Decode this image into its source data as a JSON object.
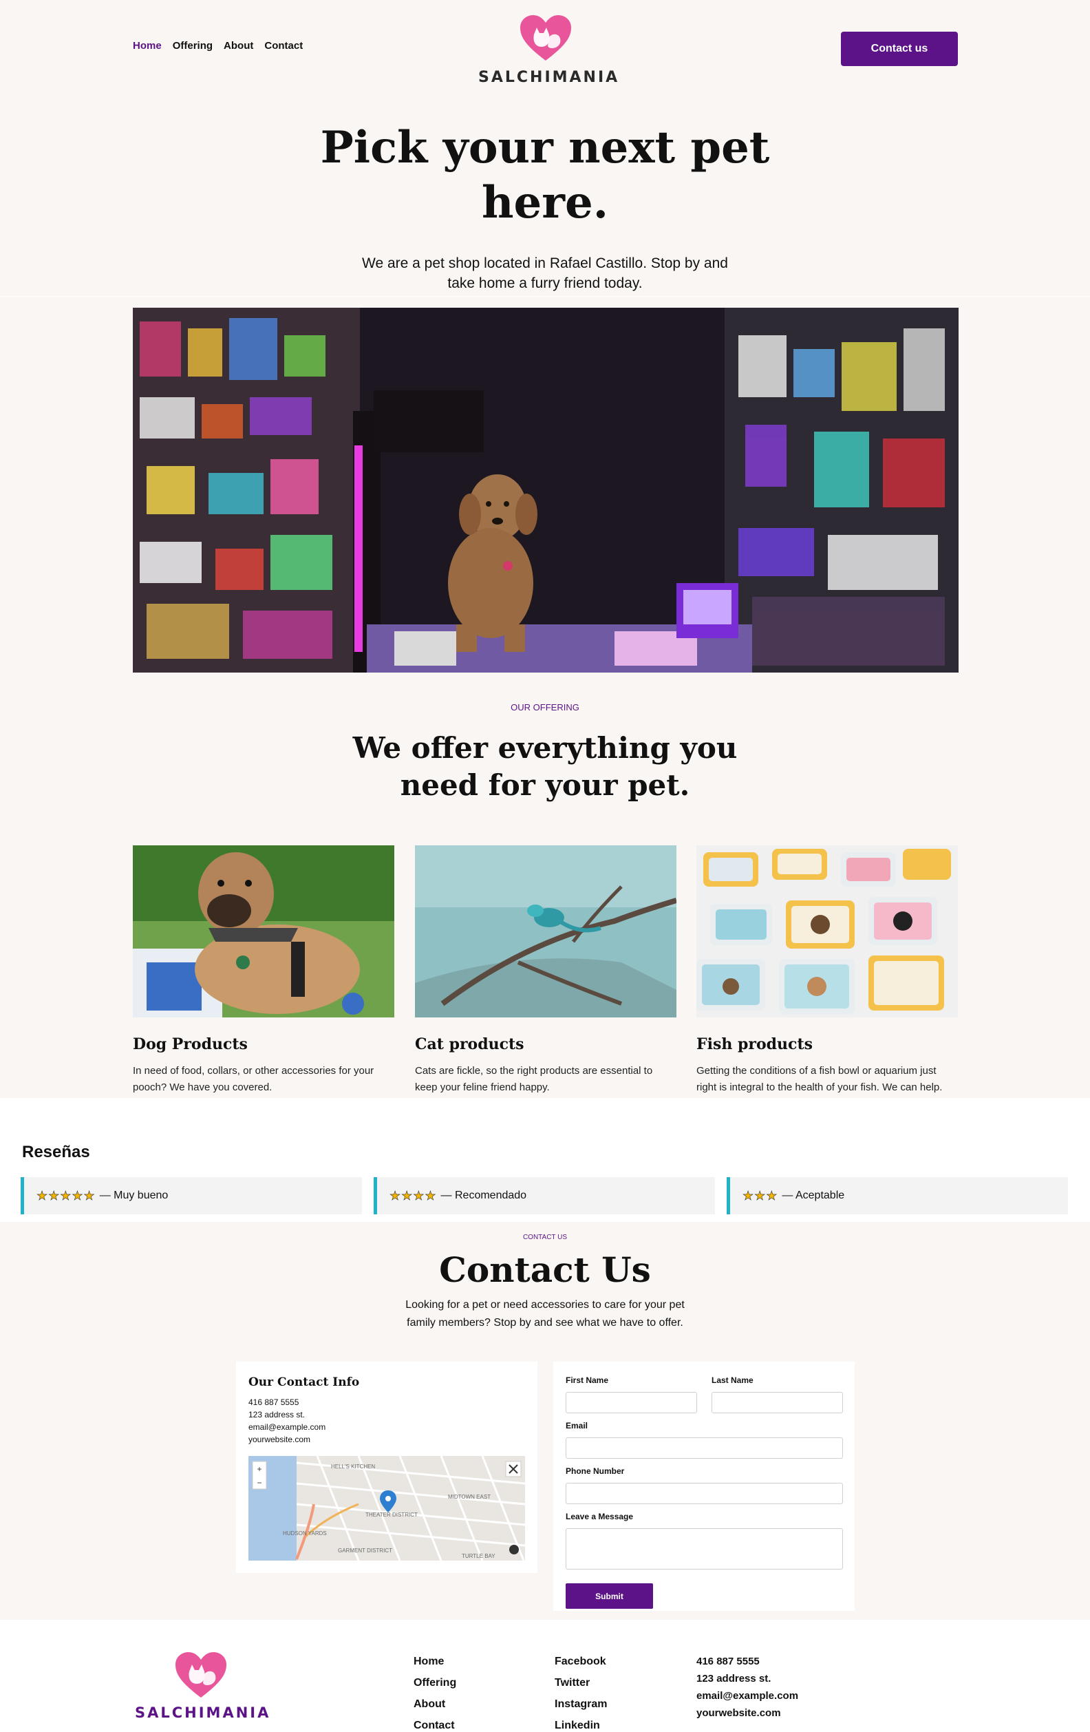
{
  "header": {
    "nav": [
      "Home",
      "Offering",
      "About",
      "Contact"
    ],
    "logo_text": "SALCHIMANIA",
    "contact_button": "Contact us"
  },
  "hero": {
    "title_line1": "Pick your next pet",
    "title_line2": "here.",
    "subtitle_line1": "We are a pet shop located in Rafael Castillo. Stop by and",
    "subtitle_line2": "take home a furry friend today."
  },
  "offering": {
    "eyebrow": "OUR OFFERING",
    "title_line1": "We offer everything you",
    "title_line2": "need for your pet.",
    "cards": [
      {
        "title": "Dog Products",
        "text_line1": "In need of food, collars, or other accessories for your",
        "text_line2": "pooch? We have you covered."
      },
      {
        "title": "Cat products",
        "text_line1": "Cats are fickle, so the right products are essential to",
        "text_line2": "keep your feline friend happy."
      },
      {
        "title": "Fish products",
        "text_line1": "Getting the conditions of a fish bowl or aquarium just",
        "text_line2": "right is integral to the health of your fish. We can help."
      }
    ]
  },
  "reviews": {
    "title": "Reseñas",
    "items": [
      {
        "stars": "★★★★★",
        "text": "— Muy bueno"
      },
      {
        "stars": "★★★★",
        "text": "— Recomendado"
      },
      {
        "stars": "★★★",
        "text": "— Aceptable"
      }
    ]
  },
  "contact": {
    "eyebrow": "CONTACT US",
    "title": "Contact Us",
    "subtitle_line1": "Looking for a pet or need accessories to care for your pet",
    "subtitle_line2": "family members? Stop by and see what we have to offer.",
    "info_title": "Our Contact Info",
    "phone": "416 887 5555",
    "address": "123 address st.",
    "email": "email@example.com",
    "website": "yourwebsite.com",
    "map_labels": {
      "hells_kitchen": "HELL'S KITCHEN",
      "theater": "THEATER DISTRICT",
      "midtown": "MIDTOWN EAST",
      "hudson": "HUDSON YARDS",
      "garment": "GARMENT DISTRICT",
      "turtle": "TURTLE BAY",
      "plus": "+",
      "minus": "−"
    },
    "form": {
      "first_name": "First Name",
      "last_name": "Last Name",
      "email": "Email",
      "phone": "Phone Number",
      "message": "Leave a Message",
      "submit": "Submit"
    }
  },
  "footer": {
    "logo_text": "SALCHIMANIA",
    "nav": [
      "Home",
      "Offering",
      "About",
      "Contact"
    ],
    "social": [
      "Facebook",
      "Twitter",
      "Instagram",
      "Linkedin"
    ],
    "phone": "416 887 5555",
    "address": "123 address st.",
    "email": "email@example.com",
    "website": "yourwebsite.com"
  },
  "colors": {
    "brand_purple": "#5b1387",
    "logo_pink": "#e9559a",
    "review_accent": "#20b3c7",
    "page_bg": "#faf6f3"
  }
}
